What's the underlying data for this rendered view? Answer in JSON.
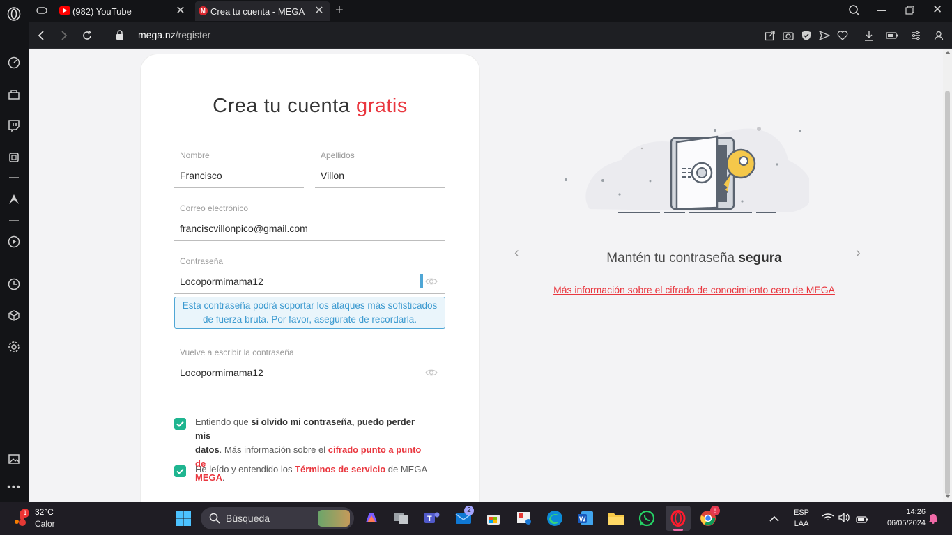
{
  "browser": {
    "tabs": [
      {
        "label": "(982) YouTube"
      },
      {
        "label": "Crea tu cuenta - MEGA"
      }
    ],
    "url_host": "mega.nz",
    "url_path": "/register"
  },
  "form": {
    "title_main": "Crea tu cuenta",
    "title_accent": "gratis",
    "first_name_label": "Nombre",
    "first_name_value": "Francisco",
    "last_name_label": "Apellidos",
    "last_name_value": "Villon",
    "email_label": "Correo electrónico",
    "email_value": "franciscvillonpico@gmail.com",
    "password_label": "Contraseña",
    "password_value": "Locopormimama12",
    "password_hint_line1": "Esta contraseña podrá soportar los ataques más sofisticados",
    "password_hint_line2": "de fuerza bruta. Por favor, asegúrate de recordarla.",
    "confirm_label": "Vuelve a escribir la contraseña",
    "confirm_value": "Locopormimama12",
    "check1_pre": "Entiendo que ",
    "check1_bold": "si olvido mi contraseña, puedo perder mis",
    "check1_bold2": "datos",
    "check1_mid": ". Más información sobre el ",
    "check1_link": "cifrado punto a punto de",
    "check1_link2": "MEGA",
    "check1_end": ".",
    "check2_pre": "He leído y entendido los ",
    "check2_link": "Términos de servicio",
    "check2_end": " de MEGA"
  },
  "carousel": {
    "title_pre": "Mantén tu contraseña ",
    "title_bold": "segura",
    "link": "Más información sobre el cifrado de conocimiento cero de MEGA"
  },
  "taskbar": {
    "weather_temp": "32°C",
    "weather_desc": "Calor",
    "search_placeholder": "Búsqueda",
    "mail_badge": "2",
    "chrome_badge": "!",
    "weather_badge": "1",
    "lang_line1": "ESP",
    "lang_line2": "LAA",
    "time": "14:26",
    "date": "06/05/2024"
  },
  "colors": {
    "accent_red": "#e9373f",
    "hint_blue": "#3c9ad0",
    "check_green": "#1fb590"
  }
}
